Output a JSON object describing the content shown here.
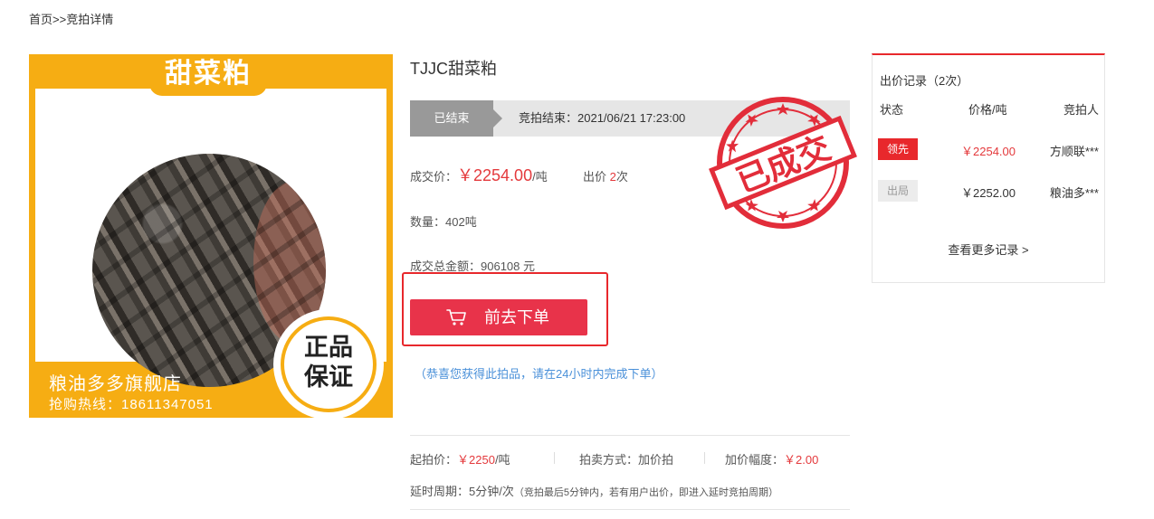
{
  "breadcrumb": {
    "home": "首页",
    "sep": ">>",
    "current": "竞拍详情"
  },
  "product_image": {
    "title": "甜菜粕",
    "store": "粮油多多旗舰店",
    "hotline": "抢购热线：18611347051",
    "badge_line1": "正品",
    "badge_line2": "保证"
  },
  "product": {
    "title": "TJJC甜菜粕",
    "status": "已结束",
    "end_time": "竞拍结束：2021/06/21 17:23:00",
    "deal_price_label": "成交价：",
    "deal_price": "￥2254.00",
    "deal_price_unit": "/吨",
    "bid_label": "出价 ",
    "bid_count": "2",
    "bid_suffix": "次",
    "quantity": "数量：402吨",
    "total": "成交总金额：906108 元",
    "order_button": "前去下单",
    "congrats": "（恭喜您获得此拍品，请在24小时内完成下单）",
    "stamp_text": "已成交"
  },
  "details": {
    "start_price_label": "起拍价：",
    "start_price": "￥2250",
    "start_price_unit": "/吨",
    "method": "拍卖方式：加价拍",
    "increment_label": "加价幅度：",
    "increment": "￥2.00",
    "delay_label": "延时周期：5分钟/次",
    "delay_note": "（竞拍最后5分钟内，若有用户出价，即进入延时竞拍周期）"
  },
  "records": {
    "header": "出价记录（2次）",
    "columns": [
      "状态",
      "价格/吨",
      "竞拍人"
    ],
    "rows": [
      {
        "status": "领先",
        "price": "￥2254.00",
        "bidder": "方顺联***"
      },
      {
        "status": "出局",
        "price": "￥2252.00",
        "bidder": "粮油多***"
      }
    ],
    "more": "查看更多记录 >"
  },
  "colors": {
    "accent": "#e8282c",
    "button": "#e8334a",
    "image_frame": "#f6ad13",
    "link": "#4a90d9"
  }
}
